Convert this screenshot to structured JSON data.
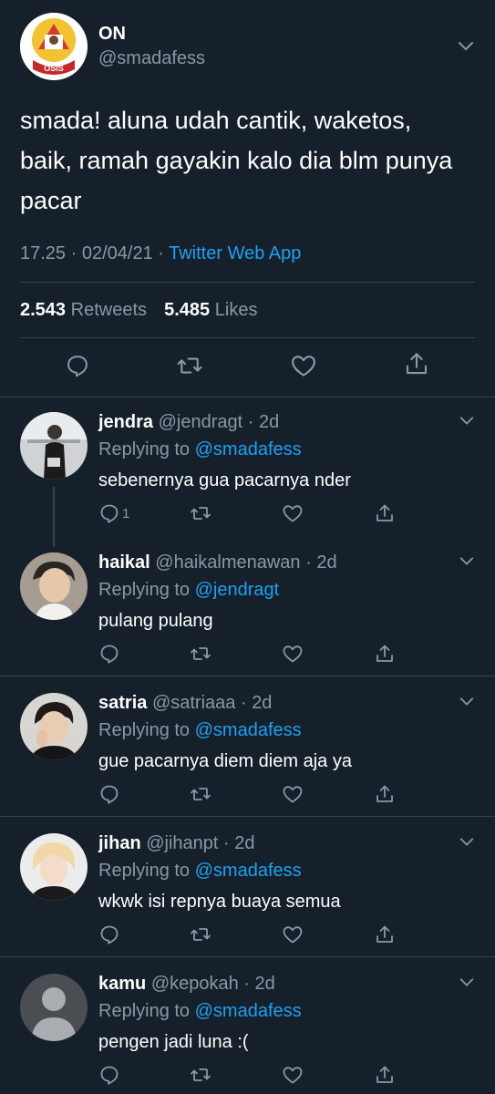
{
  "main_tweet": {
    "display_name": "ON",
    "handle": "@smadafess",
    "avatar_text": "OSIS",
    "text": "smada! aluna udah cantik, waketos, baik, ramah gayakin kalo dia blm punya pacar",
    "time": "17.25",
    "date": "02/04/21",
    "source": "Twitter Web App",
    "retweets_count": "2.543",
    "retweets_label": "Retweets",
    "likes_count": "5.485",
    "likes_label": "Likes"
  },
  "replies": [
    {
      "name": "jendra",
      "handle": "@jendragt",
      "age": "2d",
      "replying_label": "Replying to",
      "replying_to": "@smadafess",
      "text": "sebenernya gua pacarnya nder",
      "reply_count": "1"
    },
    {
      "name": "haikal",
      "handle": "@haikalmenawan",
      "age": "2d",
      "replying_label": "Replying to",
      "replying_to": "@jendragt",
      "text": "pulang pulang",
      "reply_count": ""
    },
    {
      "name": "satria",
      "handle": "@satriaaa",
      "age": "2d",
      "replying_label": "Replying to",
      "replying_to": "@smadafess",
      "text": "gue pacarnya diem diem aja ya",
      "reply_count": ""
    },
    {
      "name": "jihan",
      "handle": "@jihanpt",
      "age": "2d",
      "replying_label": "Replying to",
      "replying_to": "@smadafess",
      "text": "wkwk isi repnya buaya semua",
      "reply_count": ""
    },
    {
      "name": "kamu",
      "handle": "@kepokah",
      "age": "2d",
      "replying_label": "Replying to",
      "replying_to": "@smadafess",
      "text": "pengen jadi luna :(",
      "reply_count": ""
    }
  ],
  "colors": {
    "background": "#15202b",
    "accent": "#1da1f2",
    "muted": "#8899a6",
    "divider": "#38444d"
  },
  "icons": [
    "reply-icon",
    "retweet-icon",
    "like-icon",
    "share-icon",
    "chevron-down-icon"
  ]
}
